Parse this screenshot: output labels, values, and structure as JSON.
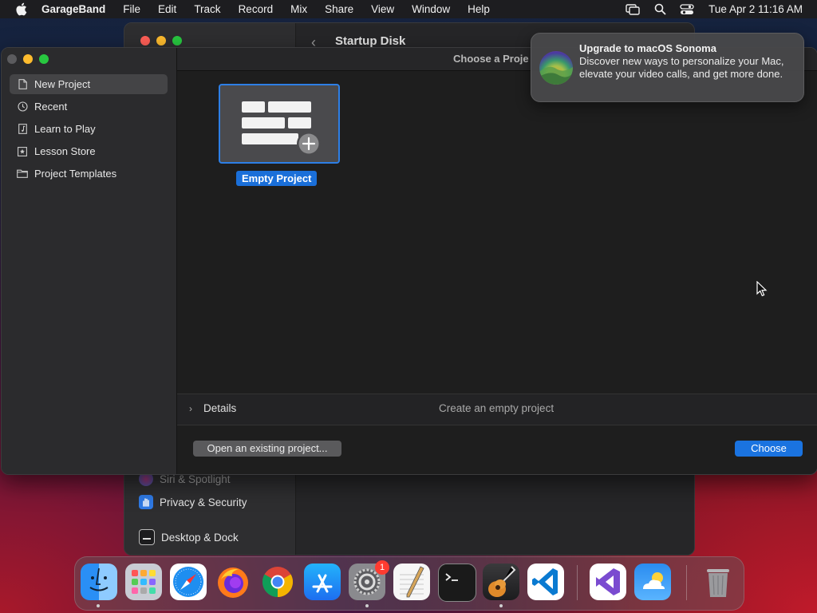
{
  "menubar": {
    "app": "GarageBand",
    "items": [
      "File",
      "Edit",
      "Track",
      "Record",
      "Mix",
      "Share",
      "View",
      "Window",
      "Help"
    ],
    "clock": "Tue Apr 2  11:16 AM",
    "status_icons": [
      "screen-mirroring-icon",
      "search-icon",
      "control-center-icon"
    ]
  },
  "background_window": {
    "title": "Startup Disk",
    "items": [
      "Siri & Spotlight",
      "Privacy & Security",
      "Desktop & Dock"
    ]
  },
  "sidebar": {
    "items": [
      {
        "label": "New Project",
        "icon": "document-icon",
        "selected": true
      },
      {
        "label": "Recent",
        "icon": "clock-icon"
      },
      {
        "label": "Learn to Play",
        "icon": "music-note-icon"
      },
      {
        "label": "Lesson Store",
        "icon": "star-icon"
      },
      {
        "label": "Project Templates",
        "icon": "folder-icon"
      }
    ]
  },
  "main": {
    "window_title": "Choose a Proje",
    "project": {
      "label": "Empty Project"
    },
    "details": {
      "label": "Details",
      "description": "Create an empty project"
    },
    "open_button": "Open an existing project...",
    "choose_button": "Choose"
  },
  "notification": {
    "title": "Upgrade to macOS Sonoma",
    "body": "Discover new ways to personalize your Mac, elevate your video calls, and get more done."
  },
  "dock": {
    "apps": [
      "Finder",
      "Launchpad",
      "Safari",
      "Firefox",
      "Chrome",
      "App Store",
      "System Settings",
      "TextEdit",
      "Terminal",
      "GarageBand",
      "Visual Studio Code",
      "Visual Studio",
      "Weather",
      "Trash"
    ],
    "system_settings_badge": "1"
  },
  "colors": {
    "accent": "#1a73e0",
    "selection": "#444446"
  }
}
